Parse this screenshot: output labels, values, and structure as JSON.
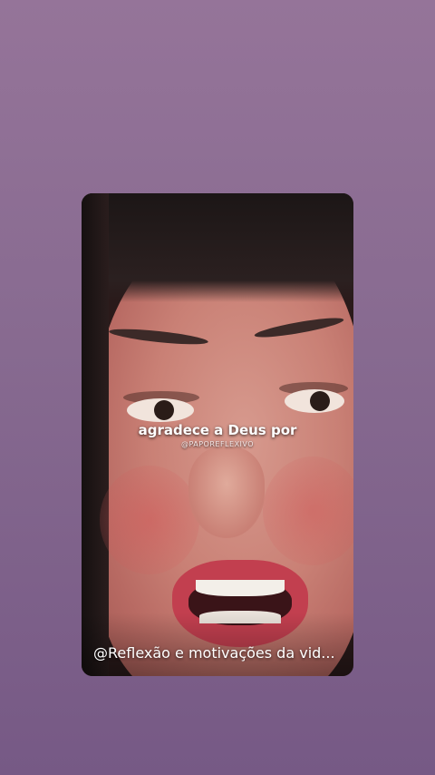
{
  "story": {
    "overlay_caption": "agradece a Deus por",
    "overlay_handle": "@PAPOREFLEXIVO",
    "title": "@Reflexão e motivações da vid..."
  },
  "colors": {
    "background_top": "#957499",
    "background_bottom": "#765985"
  }
}
